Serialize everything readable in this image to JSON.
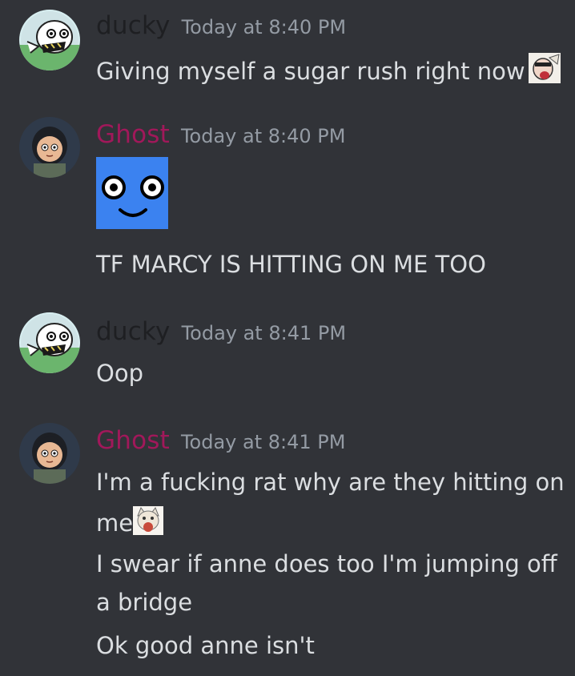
{
  "messages": [
    {
      "username": "ducky",
      "username_color": "#1e1f22",
      "timestamp": "Today at 8:40 PM",
      "avatar_icon": "goose-avatar",
      "lines": [
        "Giving myself a sugar rush right now"
      ],
      "inline_emoji": "screaming-character-emoji"
    },
    {
      "username": "Ghost",
      "username_color": "#a1185a",
      "timestamp": "Today at 8:40 PM",
      "avatar_icon": "cartoon-girl-avatar",
      "sticker": "blue-face-sticker",
      "lines": [
        "TF MARCY IS HITTING ON ME TOO"
      ]
    },
    {
      "username": "ducky",
      "username_color": "#1e1f22",
      "timestamp": "Today at 8:41 PM",
      "avatar_icon": "goose-avatar",
      "lines": [
        "Oop"
      ]
    },
    {
      "username": "Ghost",
      "username_color": "#a1185a",
      "timestamp": "Today at 8:41 PM",
      "avatar_icon": "cartoon-girl-avatar",
      "lines": [
        "I'm a fucking rat why are they hitting on",
        "me",
        "I swear if anne does too I'm jumping off",
        "a bridge",
        "Ok good anne isn't"
      ],
      "inline_emoji": "screaming-cat-emoji"
    }
  ]
}
